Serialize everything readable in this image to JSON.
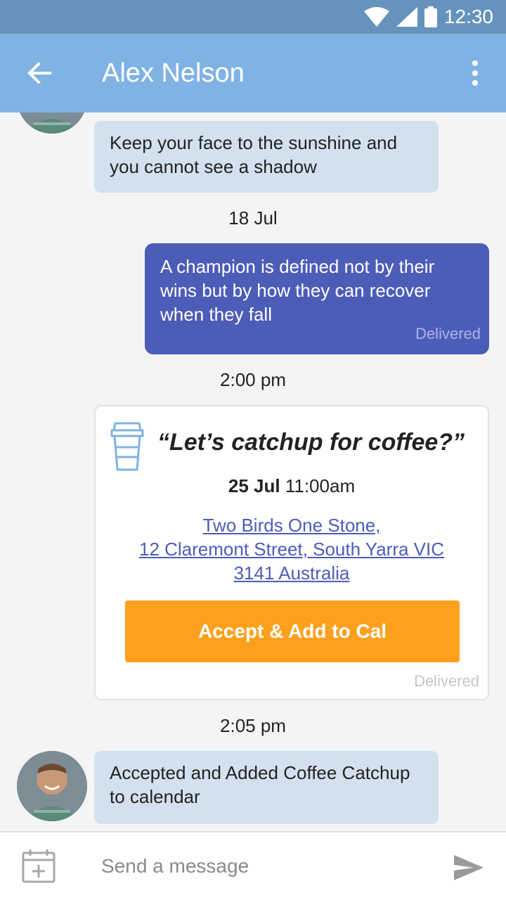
{
  "status_bar": {
    "time": "12:30"
  },
  "header": {
    "title": "Alex Nelson"
  },
  "messages": [
    {
      "text": "Keep your face to the sunshine and you cannot see a shadow"
    },
    {
      "text": "A champion is defined not by their wins but by how they can recover when they fall",
      "status": "Delivered"
    },
    {
      "text": "Accepted and Added Coffee Catchup to calendar"
    }
  ],
  "timestamps": [
    "18 Jul",
    "2:00 pm",
    "2:05 pm"
  ],
  "invite_card": {
    "title": "“Let’s catchup for coffee?”",
    "date": "25 Jul",
    "time": "11:00am",
    "address_line1": "Two Birds One Stone,",
    "address_line2": "12 Claremont Street, South Yarra VIC",
    "address_line3": "3141 Australia",
    "button_label": "Accept & Add to Cal",
    "status": "Delivered",
    "icon": "coffee-cup-icon"
  },
  "composer": {
    "placeholder": "Send a message"
  },
  "colors": {
    "status_bar": "#6693bd",
    "app_bar": "#80b3e3",
    "incoming_bubble": "#d3e1ee",
    "outgoing_bubble": "#4c5db8",
    "accept_button": "#fea01e",
    "link": "#4c5db8"
  }
}
